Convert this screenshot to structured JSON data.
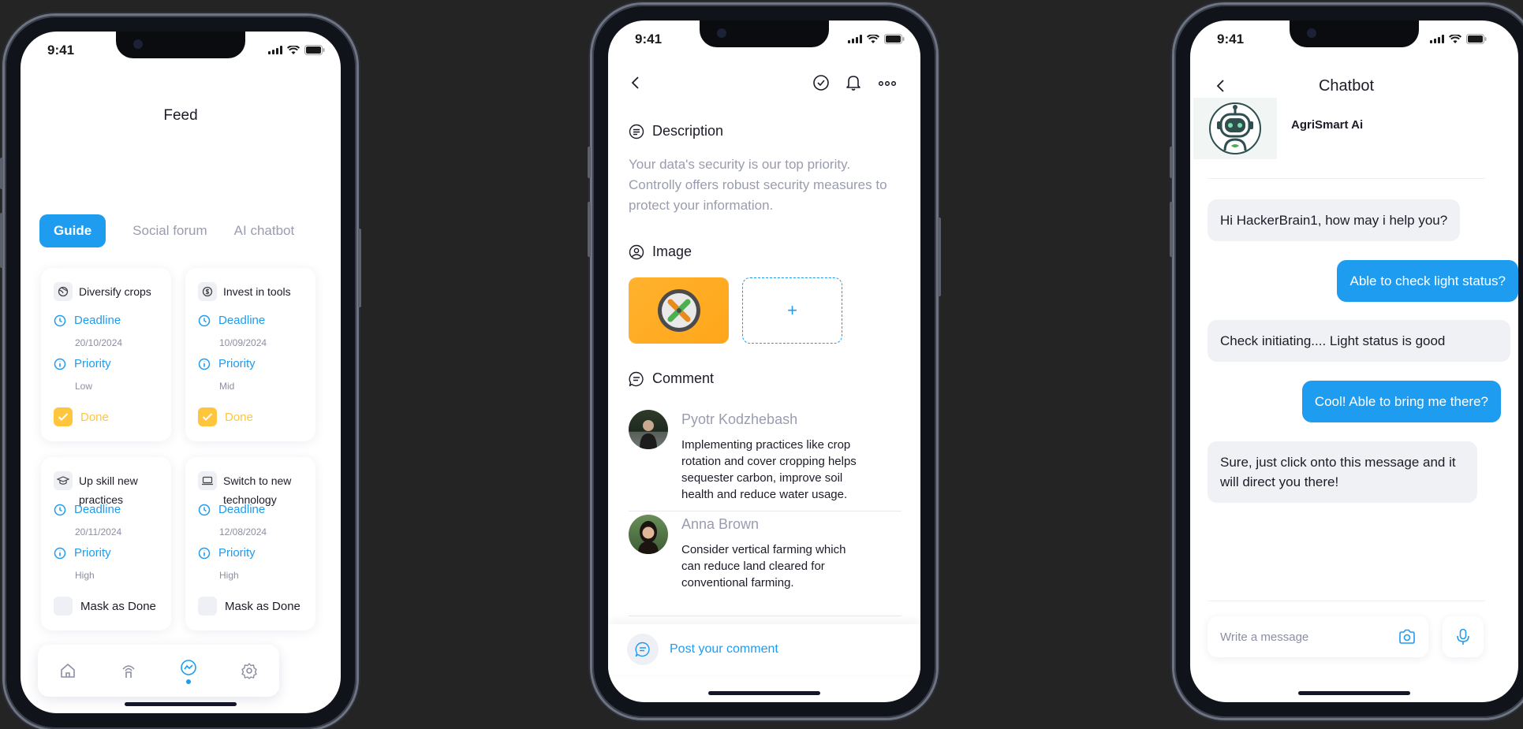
{
  "status_time": "9:41",
  "feed": {
    "title": "Feed",
    "tabs": [
      "Guide",
      "Social forum",
      "AI chatbot"
    ],
    "cards": [
      {
        "title": "Diversify crops",
        "deadline_label": "Deadline",
        "deadline": "20/10/2024",
        "priority_label": "Priority",
        "priority": "Low",
        "action": "Done",
        "done": true,
        "icon": "globe-icon"
      },
      {
        "title": "Invest in tools",
        "deadline_label": "Deadline",
        "deadline": "10/09/2024",
        "priority_label": "Priority",
        "priority": "Mid",
        "action": "Done",
        "done": true,
        "icon": "coin-icon"
      },
      {
        "title": "Up skill new practices",
        "deadline_label": "Deadline",
        "deadline": "20/11/2024",
        "priority_label": "Priority",
        "priority": "High",
        "action": "Mask as Done",
        "done": false,
        "icon": "graduation-cap-icon"
      },
      {
        "title": "Switch to new technology",
        "deadline_label": "Deadline",
        "deadline": "12/08/2024",
        "priority_label": "Priority",
        "priority": "High",
        "action": "Mask as Done",
        "done": false,
        "icon": "laptop-icon"
      }
    ],
    "nav_items": [
      "home-icon",
      "signal-tower-icon",
      "activity-icon",
      "settings-icon"
    ],
    "active_nav": "activity-icon"
  },
  "detail": {
    "description_heading": "Description",
    "description_text": "Your data's security is our top priority. Controlly offers robust security measures to protect your information.",
    "image_heading": "Image",
    "add_label": "+",
    "comment_heading": "Comment",
    "comments": [
      {
        "name": "Pyotr Kodzhebash",
        "text": " Implementing practices like crop rotation and cover cropping helps sequester carbon, improve soil health and reduce water usage."
      },
      {
        "name": "Anna Brown",
        "text": "Consider vertical farming which can reduce land cleared for conventional farming."
      }
    ],
    "post_placeholder": "Post your comment"
  },
  "chatbot": {
    "title": "Chatbot",
    "bot_name": "AgriSmart Ai",
    "messages": [
      {
        "from": "bot",
        "text": "Hi HackerBrain1, how may i help you?"
      },
      {
        "from": "user",
        "text": "Able to check light status?"
      },
      {
        "from": "bot",
        "text": "Check initiating....  Light status is good"
      },
      {
        "from": "user",
        "text": "Cool! Able to bring me there?"
      },
      {
        "from": "bot",
        "text": "Sure, just click onto this message and it will direct you there!"
      }
    ],
    "input_placeholder": "Write a message"
  },
  "colors": {
    "accent": "#1E9CF0",
    "done": "#FFC53D",
    "background": "#242424"
  }
}
